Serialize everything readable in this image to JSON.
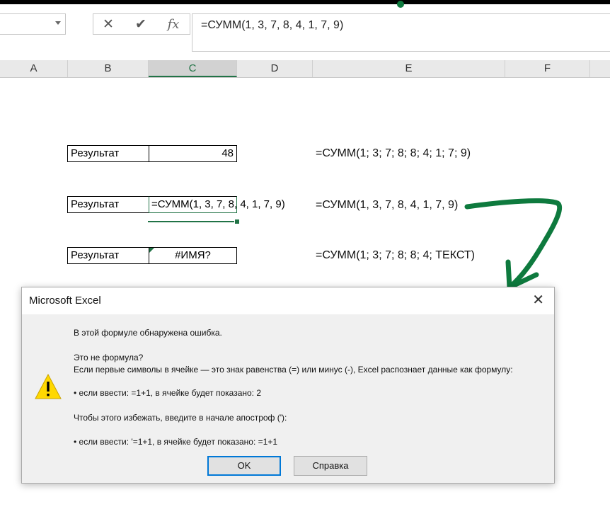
{
  "formula_bar": {
    "text": "=СУММ(1, 3, 7,  8, 4, 1, 7, 9)",
    "cancel_glyph": "✕",
    "enter_glyph": "✔",
    "fx_label": "fx"
  },
  "columns": [
    "A",
    "B",
    "C",
    "D",
    "E",
    "F"
  ],
  "rows": [
    {
      "label": "Результат",
      "value": "48",
      "formula": "=СУММ(1; 3; 7; 8; 8; 4; 1; 7; 9)"
    },
    {
      "label": "Результат",
      "value": "=СУММ(1, 3, 7,  8, 4, 1, 7, 9)",
      "formula": "=СУММ(1, 3, 7,  8, 4, 1, 7, 9)"
    },
    {
      "label": "Результат",
      "value": "#ИМЯ?",
      "formula": "=СУММ(1; 3; 7; 8; 8; 4; ТЕКСТ)"
    }
  ],
  "dialog": {
    "title": "Microsoft Excel",
    "close_glyph": "✕",
    "lines": [
      "В этой формуле обнаружена ошибка.",
      "Это не формула?",
      "Если первые символы в ячейке — это знак равенства (=) или минус (-), Excel распознает данные как формулу:",
      "• если ввести: =1+1, в ячейке будет показано: 2",
      "Чтобы этого избежать, введите в начале апостроф ('):",
      "• если ввести: '=1+1, в ячейке будет показано: =1+1"
    ],
    "ok_label": "OK",
    "help_label": "Справка"
  },
  "colors": {
    "accent_green": "#217346",
    "annotation_arrow": "#0e7a3e",
    "warning_yellow": "#ffd800",
    "dialog_focus": "#0078d7"
  },
  "icons": {
    "warning": "warning-icon",
    "arrow": "curved-arrow-annotation"
  }
}
